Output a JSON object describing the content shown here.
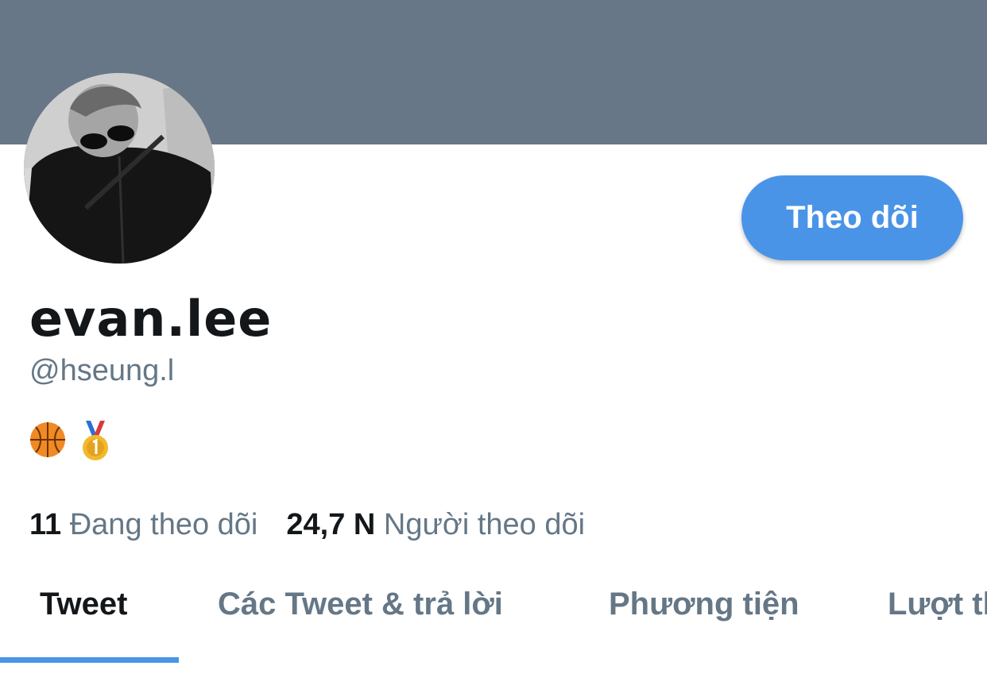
{
  "colors": {
    "banner": "#687787",
    "accent": "#4a94e8",
    "text_primary": "#14171a",
    "text_secondary": "#657786"
  },
  "profile": {
    "display_name": "evan.lee",
    "handle": "@hseung.l",
    "bio_icons": [
      "basketball-icon",
      "gold-medal-icon"
    ],
    "follow_button_label": "Theo dõi"
  },
  "stats": {
    "following_count": "11",
    "following_label": "Đang theo dõi",
    "followers_count": "24,7 N",
    "followers_label": "Người theo dõi"
  },
  "tabs": [
    {
      "label": "Tweet",
      "active": true
    },
    {
      "label": "Các Tweet & trả lời",
      "active": false
    },
    {
      "label": "Phương tiện",
      "active": false
    },
    {
      "label": "Lượt thích",
      "active": false
    }
  ]
}
